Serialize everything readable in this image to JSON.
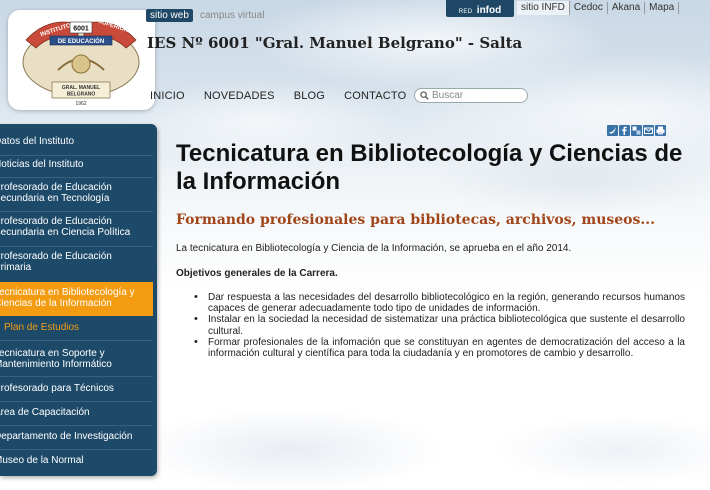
{
  "header": {
    "tag_active": "sitio web",
    "tag_inactive": "campus virtual",
    "site_title": "IES Nº 6001 \"Gral. Manuel Belgrano\" - Salta"
  },
  "logo": {
    "arc_left": "INSTITUTO",
    "number": "6001",
    "arc_right": "SUPERIOR",
    "banner": "DE EDUCACIÓN",
    "ribbon_line1": "GRAL. MANUEL",
    "ribbon_line2": "BELGRANO",
    "year": "1962"
  },
  "top_links": {
    "red_small": "RED",
    "red_big": "infod",
    "items": [
      "sitio INFD",
      "Cedoc",
      "Akana",
      "Mapa"
    ]
  },
  "nav": {
    "items": [
      "INICIO",
      "NOVEDADES",
      "BLOG",
      "CONTACTO"
    ],
    "search_placeholder": "Buscar"
  },
  "sidebar": {
    "items": [
      {
        "label": "Datos del Instituto"
      },
      {
        "label": "Noticias del Instituto"
      },
      {
        "label_lines": [
          "Profesorado de Educación",
          "Secundaria en Tecnología"
        ]
      },
      {
        "label_lines": [
          "Profesorado de Educación",
          "Secundaria en Ciencia Política"
        ]
      },
      {
        "label_lines": [
          "Profesorado de Educación",
          "Primaria"
        ]
      },
      {
        "label_lines": [
          "Tecnicatura en Bibliotecología y",
          "Ciencias de la Información"
        ]
      },
      {
        "label": "Plan de Estudios"
      },
      {
        "label_lines": [
          "Tecnicatura en Soporte y",
          "Mantenimiento Informático"
        ]
      },
      {
        "label": "Profesorado para Técnicos"
      },
      {
        "label": "Area de Capacitación"
      },
      {
        "label": "Departamento de Investigación"
      },
      {
        "label": "Museo de la Normal"
      }
    ]
  },
  "social": [
    "twitter-icon",
    "facebook-icon",
    "delicious-icon",
    "email-icon",
    "print-icon"
  ],
  "colors": {
    "sidebar_bg": "#1e4a6a",
    "active_item": "#f39c12",
    "subtitle": "#a0451a",
    "brand_blue": "#1f4866"
  },
  "main": {
    "title": "Tecnicatura en Bibliotecología y Ciencias de la Información",
    "subtitle": "Formando profesionales para bibliotecas, archivos, museos...",
    "intro": "La tecnicatura en Bibliotecología y Ciencia de la Información, se aprueba en el año 2014.",
    "objectives_heading": "Objetivos generales de la Carrera.",
    "bullets": [
      "Dar respuesta a las necesidades del desarrollo bibliotecológico en la región, generando recursos humanos capaces de generar adecuadamente todo tipo de unidades de información.",
      "Instalar en la sociedad la necesidad de sistematizar una práctica bibliotecológica que sustente el desarrollo cultural.",
      "Formar profesionales de la infomación que se constituyan en agentes de democratización del acceso a la información cultural y científica para toda la ciudadanía y en promotores de cambio y desarrollo."
    ]
  }
}
